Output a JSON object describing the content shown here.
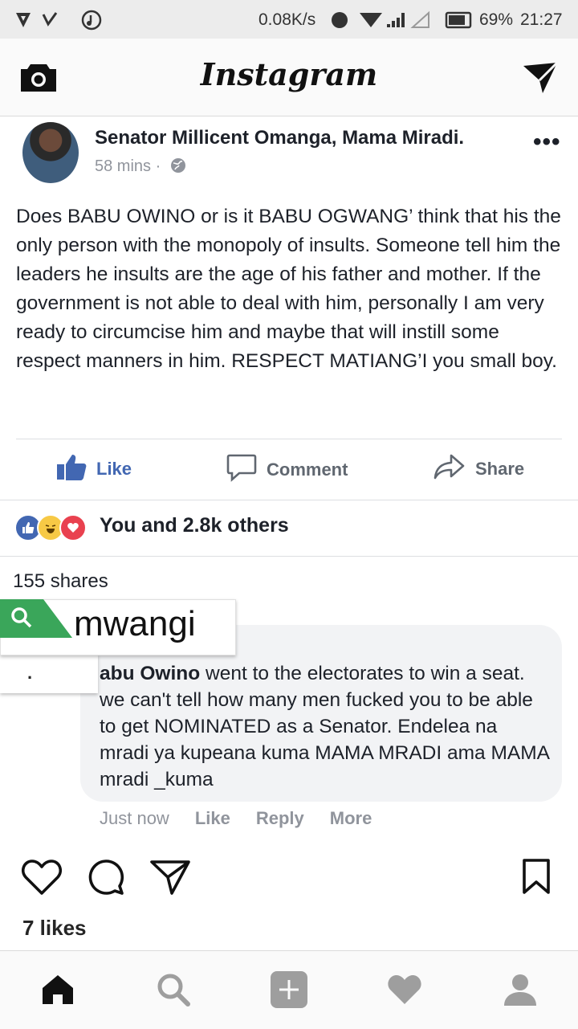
{
  "status_bar": {
    "speed": "0.08K/s",
    "battery": "69%",
    "time": "21:27"
  },
  "header": {
    "brand": "Instagram",
    "camera_icon": "camera-icon",
    "direct_icon": "direct-message-icon"
  },
  "post_screenshot": {
    "author": "Senator Millicent Omanga, Mama Miradi.",
    "time": "58 mins ·",
    "body": "Does BABU OWINO or is it BABU OGWANG’ think that his the only person with the monopoly of insults. Someone tell him the leaders he insults are the age of his father and mother. If the government is not able to deal with him, personally I am very ready to circumcise him and maybe that will instill some respect manners in him. RESPECT MATIANG’I you small boy.",
    "actions": {
      "like": "Like",
      "comment": "Comment",
      "share": "Share"
    },
    "reactions_text": "You and 2.8k others",
    "shares": "155 shares",
    "comment": {
      "author": "abu Owino",
      "text": "went to the electorates to win a seat. we can't tell how many men fucked you to be able to get NOMINATED as a Senator. Endelea na mradi ya kupeana kuma MAMA MRADI ama MAMA mradi _kuma",
      "time": "Just now",
      "like": "Like",
      "reply": "Reply",
      "more": "More"
    },
    "overlay_word": "mwangi"
  },
  "ig_actions": {
    "likes": "7 likes"
  },
  "colors": {
    "fb_blue": "#4267b2",
    "haha_yellow": "#f7c945",
    "love_red": "#e9414f",
    "overlay_green": "#3aa65a"
  }
}
